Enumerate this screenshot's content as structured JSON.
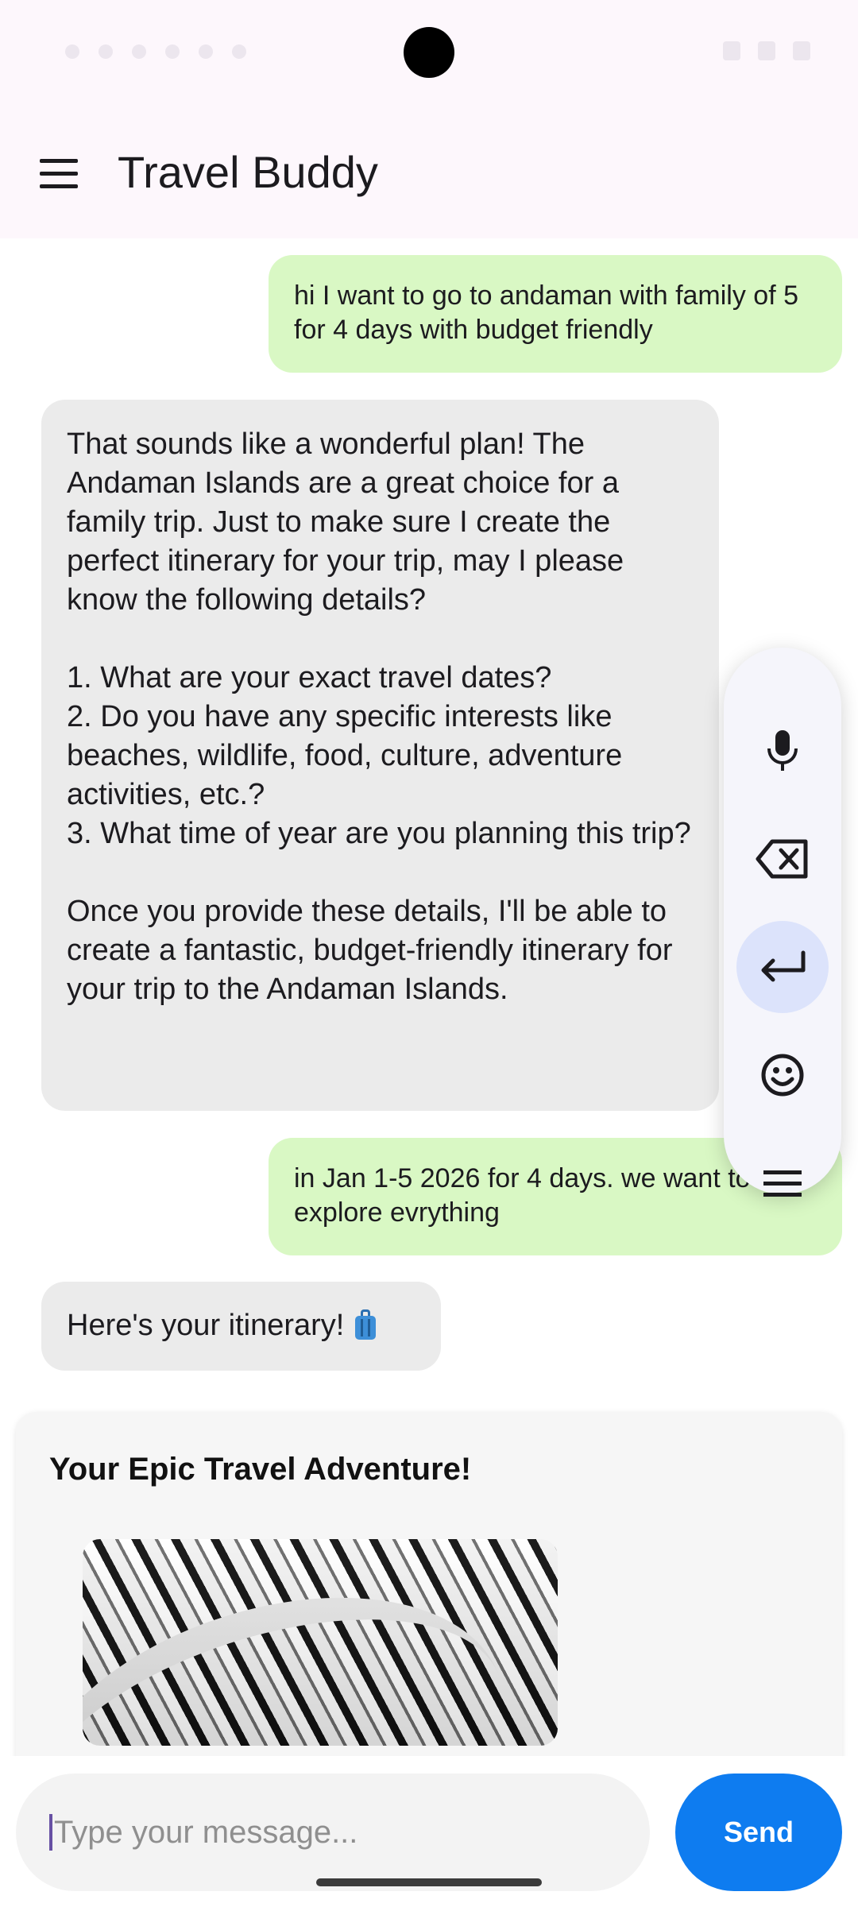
{
  "app": {
    "title": "Travel Buddy"
  },
  "messages": [
    {
      "role": "user",
      "text": "hi I want to go to andaman with family of 5 for 4 days with budget friendly"
    },
    {
      "role": "assistant",
      "text": "That sounds like a wonderful plan! The Andaman Islands are a great choice for a family trip. Just to make sure I create the perfect itinerary for your trip, may I please know the following details?\n\n1. What are your exact travel dates?\n2. Do you have any specific interests like beaches, wildlife, food, culture, adventure activities, etc.?\n3. What time of year are you planning this trip?\n\nOnce you provide these details, I'll be able to create a fantastic, budget-friendly itinerary for your trip to the Andaman Islands."
    },
    {
      "role": "user",
      "text": "in Jan 1-5 2026 for 4 days. we want to explore evrything"
    },
    {
      "role": "assistant",
      "text": "Here's your itinerary!",
      "emoji": "luggage-icon"
    }
  ],
  "itinerary_card": {
    "title": "Your Epic Travel Adventure!"
  },
  "floating_toolbar": {
    "items": [
      "microphone-icon",
      "backspace-icon",
      "enter-icon",
      "emoji-icon",
      "menu-icon"
    ],
    "active": "enter-icon"
  },
  "composer": {
    "placeholder": "Type your message...",
    "send_label": "Send"
  },
  "colors": {
    "user_bubble": "#d9f8c4",
    "assistant_bubble": "#ebebeb",
    "send_button": "#0e7cf0",
    "app_bar": "#fdf7fc"
  }
}
